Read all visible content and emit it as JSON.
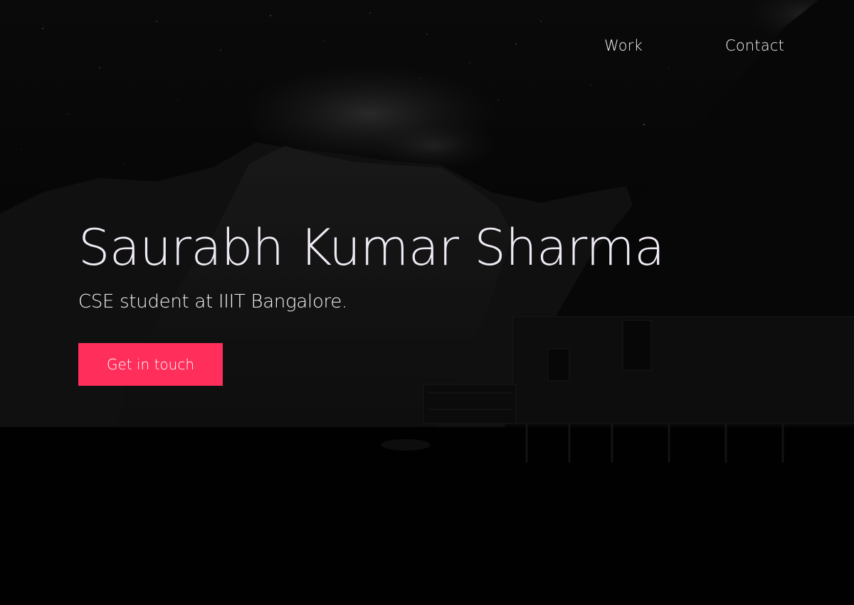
{
  "nav": {
    "work_label": "Work",
    "contact_label": "Contact"
  },
  "hero": {
    "name": "Saurabh Kumar Sharma",
    "tagline": "CSE student at IIIT Bangalore.",
    "cta_label": "Get in touch"
  },
  "colors": {
    "accent": "#ff2e5b",
    "heading_text": "#f0eaf4",
    "background": "#060606"
  }
}
